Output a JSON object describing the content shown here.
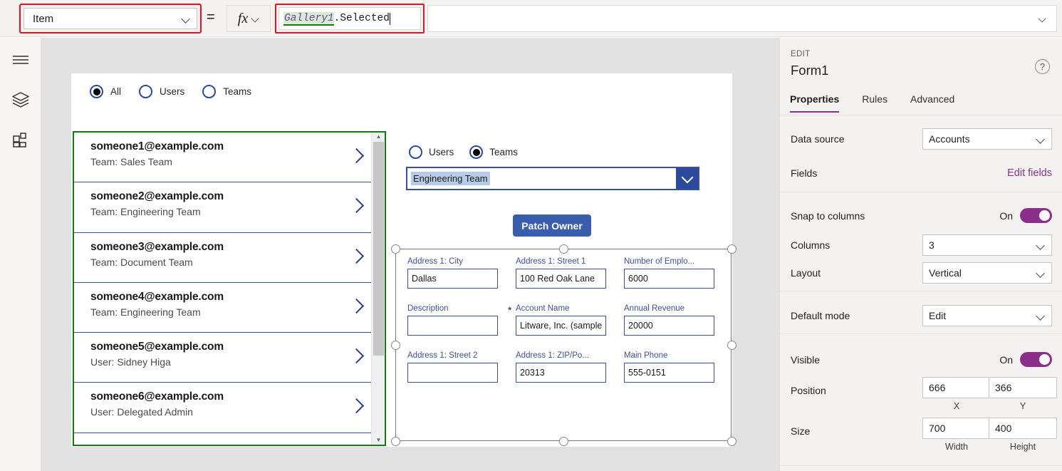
{
  "formula_bar": {
    "property_selected": "Item",
    "equals": "=",
    "fx_label": "fx",
    "formula_identifier": "Gallery1",
    "formula_rest": ".Selected"
  },
  "left_rail": {
    "items": [
      {
        "icon": "hamburger-menu-icon",
        "name": "menu"
      },
      {
        "icon": "layers-icon",
        "name": "tree-view"
      },
      {
        "icon": "insert-grid-icon",
        "name": "insert"
      }
    ]
  },
  "canvas": {
    "radio_top": {
      "options": [
        {
          "label": "All",
          "selected": true
        },
        {
          "label": "Users",
          "selected": false
        },
        {
          "label": "Teams",
          "selected": false
        }
      ]
    },
    "radio_form": {
      "options": [
        {
          "label": "Users",
          "selected": false
        },
        {
          "label": "Teams",
          "selected": true
        }
      ]
    },
    "gallery": {
      "items": [
        {
          "title": "someone1@example.com",
          "subtitle": "Team: Sales Team"
        },
        {
          "title": "someone2@example.com",
          "subtitle": "Team: Engineering Team"
        },
        {
          "title": "someone3@example.com",
          "subtitle": "Team: Document Team"
        },
        {
          "title": "someone4@example.com",
          "subtitle": "Team: Engineering Team"
        },
        {
          "title": "someone5@example.com",
          "subtitle": "User: Sidney Higa"
        },
        {
          "title": "someone6@example.com",
          "subtitle": "User: Delegated Admin"
        }
      ]
    },
    "combobox": {
      "value": "Engineering Team"
    },
    "patch_button": {
      "label": "Patch Owner"
    },
    "form": {
      "fields": [
        {
          "label": "Address 1: City",
          "value": "Dallas",
          "required": false
        },
        {
          "label": "Address 1: Street 1",
          "value": "100 Red Oak Lane",
          "required": false
        },
        {
          "label": "Number of Emplo...",
          "value": "6000",
          "required": false
        },
        {
          "label": "Description",
          "value": "",
          "required": false
        },
        {
          "label": "Account Name",
          "value": "Litware, Inc. (sample",
          "required": true
        },
        {
          "label": "Annual Revenue",
          "value": "20000",
          "required": false
        },
        {
          "label": "Address 1: Street 2",
          "value": "",
          "required": false
        },
        {
          "label": "Address 1: ZIP/Po...",
          "value": "20313",
          "required": false
        },
        {
          "label": "Main Phone",
          "value": "555-0151",
          "required": false
        }
      ]
    }
  },
  "right_panel": {
    "kicker": "EDIT",
    "title": "Form1",
    "help_glyph": "?",
    "tabs": [
      {
        "label": "Properties",
        "active": true
      },
      {
        "label": "Rules",
        "active": false
      },
      {
        "label": "Advanced",
        "active": false
      }
    ],
    "data_source": {
      "label": "Data source",
      "value": "Accounts"
    },
    "fields": {
      "label": "Fields",
      "action": "Edit fields"
    },
    "snap_to_columns": {
      "label": "Snap to columns",
      "state": "On"
    },
    "columns": {
      "label": "Columns",
      "value": "3"
    },
    "layout": {
      "label": "Layout",
      "value": "Vertical"
    },
    "default_mode": {
      "label": "Default mode",
      "value": "Edit"
    },
    "visible": {
      "label": "Visible",
      "state": "On"
    },
    "position": {
      "label": "Position",
      "x": "666",
      "y": "366",
      "x_caption": "X",
      "y_caption": "Y"
    },
    "size": {
      "label": "Size",
      "width": "700",
      "height": "400",
      "width_caption": "Width",
      "height_caption": "Height"
    }
  },
  "colors": {
    "accent_purple": "#8b2f8b",
    "selection_green": "#107c10",
    "control_blue": "#3b4fa0",
    "button_blue": "#3a5dae",
    "highlight_red": "#e81123"
  }
}
